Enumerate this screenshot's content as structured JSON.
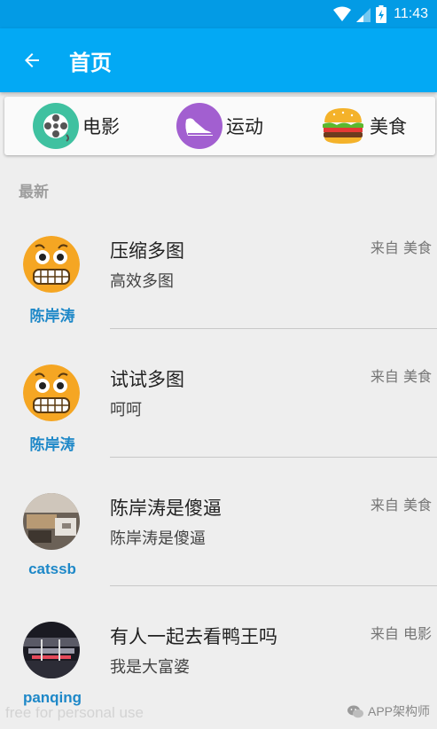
{
  "status_bar": {
    "time": "11:43",
    "icons": [
      "wifi-icon",
      "signal-icon",
      "battery-icon"
    ]
  },
  "app_bar": {
    "title": "首页",
    "back_icon": "arrow-left-icon"
  },
  "categories": [
    {
      "label": "电影",
      "icon": "film-reel-icon",
      "color": "#3fc1a0"
    },
    {
      "label": "运动",
      "icon": "sneaker-icon",
      "color": "#a25fd0"
    },
    {
      "label": "美食",
      "icon": "burger-icon",
      "color": "#f4b22a"
    }
  ],
  "feed": {
    "section_title": "最新",
    "items": [
      {
        "author": "陈岸涛",
        "title": "压缩多图",
        "subtitle": "高效多图",
        "source": "来自 美食",
        "avatar": "grimace-emoji"
      },
      {
        "author": "陈岸涛",
        "title": "试试多图",
        "subtitle": "呵呵",
        "source": "来自 美食",
        "avatar": "grimace-emoji"
      },
      {
        "author": "catssb",
        "title": "陈岸涛是傻逼",
        "subtitle": "陈岸涛是傻逼",
        "source": "来自 美食",
        "avatar": "photo-room"
      },
      {
        "author": "panqing",
        "title": "有人一起去看鸭王吗",
        "subtitle": "我是大富婆",
        "source": "来自 电影",
        "avatar": "photo-night"
      }
    ]
  },
  "watermark": {
    "left_text": "free for personal use",
    "right_text": "APP架构师"
  },
  "colors": {
    "status_bar": "#039be5",
    "app_bar": "#03a9f4",
    "author": "#1e88c8",
    "background": "#eeeeee"
  }
}
